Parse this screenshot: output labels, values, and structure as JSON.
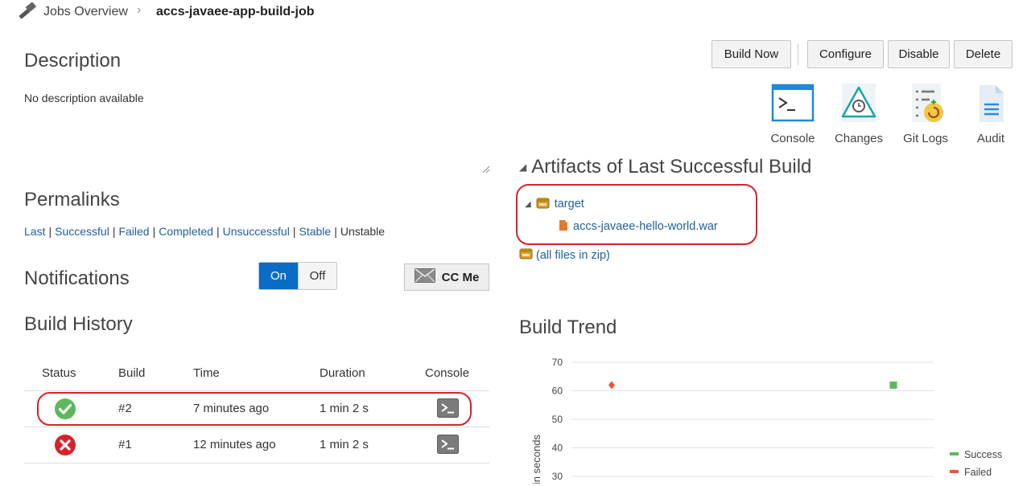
{
  "breadcrumb": {
    "parent": "Jobs Overview",
    "separator": "›",
    "current": "accs-javaee-app-build-job"
  },
  "description": {
    "title": "Description",
    "text": "No description available"
  },
  "permalinks": {
    "title": "Permalinks",
    "links": [
      "Last",
      "Successful",
      "Failed",
      "Completed",
      "Unsuccessful",
      "Stable"
    ],
    "plain": "Unstable",
    "separator": "|"
  },
  "notifications": {
    "title": "Notifications",
    "on_label": "On",
    "off_label": "Off",
    "cc_label": "CC Me"
  },
  "build_history": {
    "title": "Build History",
    "columns": [
      "Status",
      "Build",
      "Time",
      "Duration",
      "Console"
    ],
    "rows": [
      {
        "status": "success",
        "build": "#2",
        "time": "7 minutes ago",
        "duration": "1 min 2 s"
      },
      {
        "status": "failed",
        "build": "#1",
        "time": "12 minutes ago",
        "duration": "1 min 2 s"
      }
    ]
  },
  "actions": {
    "build_now": "Build Now",
    "configure": "Configure",
    "disable": "Disable",
    "delete": "Delete"
  },
  "tools": {
    "console": "Console",
    "changes": "Changes",
    "git_logs": "Git Logs",
    "audit": "Audit"
  },
  "artifacts": {
    "title": "Artifacts of Last Successful Build",
    "folder": "target",
    "file": "accs-javaee-hello-world.war",
    "zip_link": "(all files in zip)"
  },
  "build_trend": {
    "title": "Build Trend"
  },
  "chart_data": {
    "type": "scatter",
    "ylabel": "Duration in seconds",
    "ylabel_visible": "ation in seconds",
    "ylim": [
      30,
      70
    ],
    "yticks": [
      30,
      40,
      50,
      60,
      70
    ],
    "grid": true,
    "legend_placement": "bottom-right",
    "series": [
      {
        "name": "Success",
        "color": "#5cb85c",
        "marker": "square",
        "points": [
          {
            "build": "#2",
            "y": 62
          }
        ]
      },
      {
        "name": "Failed",
        "color": "#e8583c",
        "marker": "diamond",
        "points": [
          {
            "build": "#1",
            "y": 62
          }
        ]
      }
    ]
  },
  "colors": {
    "link": "#1f5fa0",
    "toggle_on": "#0a6cc4",
    "highlight": "#d8212a",
    "success": "#5cb85c",
    "failed": "#e8583c"
  }
}
